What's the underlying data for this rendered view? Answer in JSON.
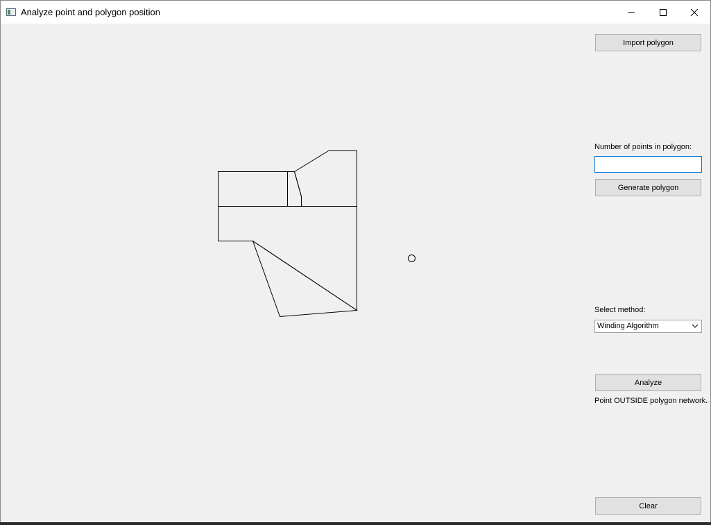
{
  "window": {
    "title": "Analyze point and polygon position",
    "icon": "app-window-icon",
    "controls": [
      "minimize-icon",
      "maximize-icon",
      "close-icon"
    ]
  },
  "sidebar": {
    "import_button": "Import polygon",
    "points_label": "Number of points in polygon:",
    "points_input_value": "",
    "generate_button": "Generate polygon",
    "method_label": "Select method:",
    "method_selected": "Winding Algorithm",
    "analyze_button": "Analyze",
    "result_text": "Point OUTSIDE polygon network.",
    "clear_button": "Clear"
  },
  "colors": {
    "window_bg": "#f0f0f0",
    "titlebar_bg": "#ffffff",
    "button_bg": "#e1e1e1",
    "button_border": "#adadad",
    "input_focus_border": "#0078d7",
    "stroke": "#000000"
  }
}
